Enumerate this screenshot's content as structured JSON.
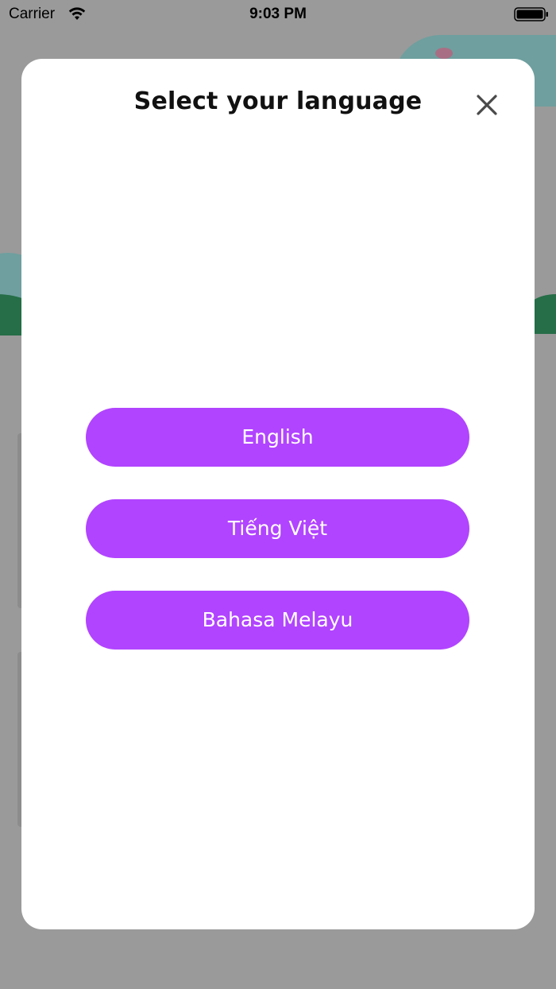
{
  "status_bar": {
    "carrier": "Carrier",
    "time": "9:03 PM",
    "wifi_icon": "wifi-icon",
    "battery_icon": "battery-icon"
  },
  "modal": {
    "title": "Select your language",
    "close_icon": "close-icon",
    "languages": [
      {
        "label": "English"
      },
      {
        "label": "Tiếng Việt"
      },
      {
        "label": "Bahasa Melayu"
      }
    ]
  },
  "colors": {
    "accent": "#b144ff",
    "overlay": "#9a9a9a",
    "modal_bg": "#ffffff"
  }
}
